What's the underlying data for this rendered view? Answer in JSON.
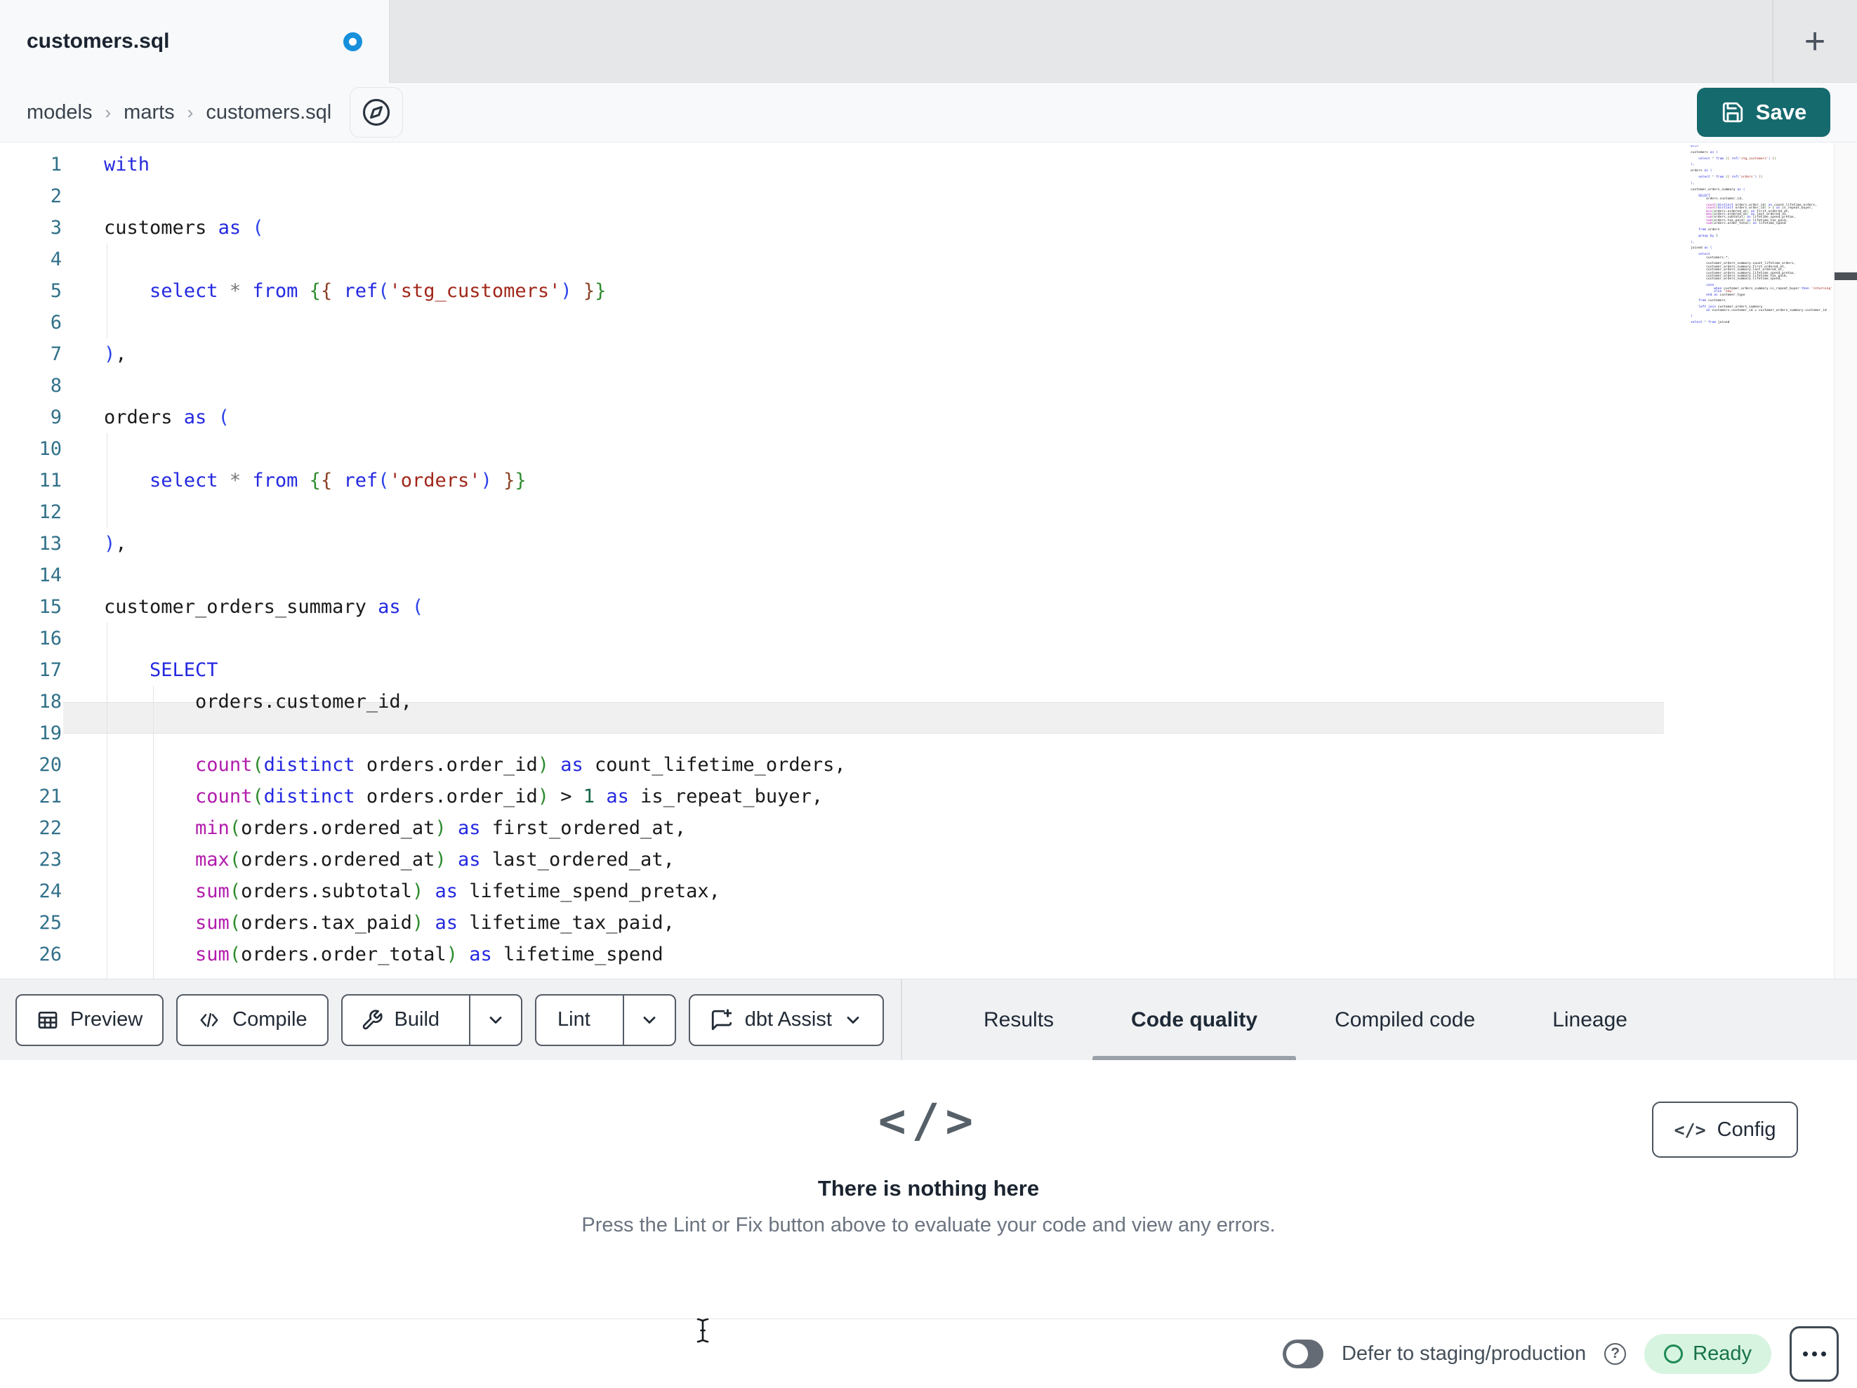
{
  "tab_bar": {
    "title": "customers.sql",
    "unsaved": true,
    "new_tab_glyph": "+"
  },
  "breadcrumb": {
    "items": [
      "models",
      "marts",
      "customers.sql"
    ],
    "separator": "›"
  },
  "save": {
    "label": "Save"
  },
  "colors": {
    "accent_teal": "#156a6e",
    "unsaved_blue": "#1790dc",
    "ready_bg": "#d7f4e1",
    "ready_text": "#177347",
    "keyword": "#2429e0",
    "function": "#b21bac",
    "string": "#a1271b",
    "number": "#116644",
    "bracket1": "#2b43e8",
    "bracket2": "#2e8b2e",
    "bracket3": "#8b4226",
    "line_number": "#31718a"
  },
  "editor": {
    "visible_lines": 26,
    "active_line": 14,
    "file_lines": [
      [
        [
          "kw",
          "with"
        ]
      ],
      [],
      [
        [
          "txt",
          "customers "
        ],
        [
          "kw",
          "as"
        ],
        [
          "txt",
          " "
        ],
        [
          "b",
          "("
        ]
      ],
      [],
      [
        [
          "txt",
          "    "
        ],
        [
          "kw",
          "select"
        ],
        [
          "txt",
          " "
        ],
        [
          "op",
          "*"
        ],
        [
          "txt",
          " "
        ],
        [
          "kw",
          "from"
        ],
        [
          "txt",
          " "
        ],
        [
          "g",
          "{"
        ],
        [
          "m",
          "{"
        ],
        [
          "txt",
          " "
        ],
        [
          "kw",
          "ref"
        ],
        [
          "b",
          "("
        ],
        [
          "str",
          "'stg_customers'"
        ],
        [
          "b",
          ")"
        ],
        [
          "txt",
          " "
        ],
        [
          "m",
          "}"
        ],
        [
          "g",
          "}"
        ]
      ],
      [],
      [
        [
          "b",
          ")"
        ],
        [
          "txt",
          ","
        ]
      ],
      [],
      [
        [
          "txt",
          "orders "
        ],
        [
          "kw",
          "as"
        ],
        [
          "txt",
          " "
        ],
        [
          "b",
          "("
        ]
      ],
      [],
      [
        [
          "txt",
          "    "
        ],
        [
          "kw",
          "select"
        ],
        [
          "txt",
          " "
        ],
        [
          "op",
          "*"
        ],
        [
          "txt",
          " "
        ],
        [
          "kw",
          "from"
        ],
        [
          "txt",
          " "
        ],
        [
          "g",
          "{"
        ],
        [
          "m",
          "{"
        ],
        [
          "txt",
          " "
        ],
        [
          "kw",
          "ref"
        ],
        [
          "b",
          "("
        ],
        [
          "str",
          "'orders'"
        ],
        [
          "b",
          ")"
        ],
        [
          "txt",
          " "
        ],
        [
          "m",
          "}"
        ],
        [
          "g",
          "}"
        ]
      ],
      [],
      [
        [
          "b",
          ")"
        ],
        [
          "txt",
          ","
        ]
      ],
      [],
      [
        [
          "txt",
          "customer_orders_summary "
        ],
        [
          "kw",
          "as"
        ],
        [
          "txt",
          " "
        ],
        [
          "b",
          "("
        ]
      ],
      [],
      [
        [
          "txt",
          "    "
        ],
        [
          "kw",
          "SELECT"
        ]
      ],
      [
        [
          "txt",
          "        orders.customer_id,"
        ]
      ],
      [],
      [
        [
          "txt",
          "        "
        ],
        [
          "fn",
          "count"
        ],
        [
          "g",
          "("
        ],
        [
          "kw",
          "distinct"
        ],
        [
          "txt",
          " orders.order_id"
        ],
        [
          "g",
          ")"
        ],
        [
          "txt",
          " "
        ],
        [
          "kw",
          "as"
        ],
        [
          "txt",
          " count_lifetime_orders,"
        ]
      ],
      [
        [
          "txt",
          "        "
        ],
        [
          "fn",
          "count"
        ],
        [
          "g",
          "("
        ],
        [
          "kw",
          "distinct"
        ],
        [
          "txt",
          " orders.order_id"
        ],
        [
          "g",
          ")"
        ],
        [
          "txt",
          " > "
        ],
        [
          "num",
          "1"
        ],
        [
          "txt",
          " "
        ],
        [
          "kw",
          "as"
        ],
        [
          "txt",
          " is_repeat_buyer,"
        ]
      ],
      [
        [
          "txt",
          "        "
        ],
        [
          "fn",
          "min"
        ],
        [
          "g",
          "("
        ],
        [
          "txt",
          "orders.ordered_at"
        ],
        [
          "g",
          ")"
        ],
        [
          "txt",
          " "
        ],
        [
          "kw",
          "as"
        ],
        [
          "txt",
          " first_ordered_at,"
        ]
      ],
      [
        [
          "txt",
          "        "
        ],
        [
          "fn",
          "max"
        ],
        [
          "g",
          "("
        ],
        [
          "txt",
          "orders.ordered_at"
        ],
        [
          "g",
          ")"
        ],
        [
          "txt",
          " "
        ],
        [
          "kw",
          "as"
        ],
        [
          "txt",
          " last_ordered_at,"
        ]
      ],
      [
        [
          "txt",
          "        "
        ],
        [
          "fn",
          "sum"
        ],
        [
          "g",
          "("
        ],
        [
          "txt",
          "orders.subtotal"
        ],
        [
          "g",
          ")"
        ],
        [
          "txt",
          " "
        ],
        [
          "kw",
          "as"
        ],
        [
          "txt",
          " lifetime_spend_pretax,"
        ]
      ],
      [
        [
          "txt",
          "        "
        ],
        [
          "fn",
          "sum"
        ],
        [
          "g",
          "("
        ],
        [
          "txt",
          "orders.tax_paid"
        ],
        [
          "g",
          ")"
        ],
        [
          "txt",
          " "
        ],
        [
          "kw",
          "as"
        ],
        [
          "txt",
          " lifetime_tax_paid,"
        ]
      ],
      [
        [
          "txt",
          "        "
        ],
        [
          "fn",
          "sum"
        ],
        [
          "g",
          "("
        ],
        [
          "txt",
          "orders.order_total"
        ],
        [
          "g",
          ")"
        ],
        [
          "txt",
          " "
        ],
        [
          "kw",
          "as"
        ],
        [
          "txt",
          " lifetime_spend"
        ]
      ],
      [],
      [
        [
          "txt",
          "    "
        ],
        [
          "kw",
          "from"
        ],
        [
          "txt",
          " orders"
        ]
      ],
      [],
      [
        [
          "txt",
          "    "
        ],
        [
          "kw",
          "group by"
        ],
        [
          "txt",
          " "
        ],
        [
          "num",
          "1"
        ]
      ],
      [],
      [
        [
          "b",
          ")"
        ],
        [
          "txt",
          ","
        ]
      ],
      [],
      [
        [
          "txt",
          "joined "
        ],
        [
          "kw",
          "as"
        ],
        [
          "txt",
          " "
        ],
        [
          "b",
          "("
        ]
      ],
      [],
      [
        [
          "txt",
          "    "
        ],
        [
          "kw",
          "select"
        ]
      ],
      [
        [
          "txt",
          "        customers.*,"
        ]
      ],
      [],
      [
        [
          "txt",
          "        customer_orders_summary.count_lifetime_orders,"
        ]
      ],
      [
        [
          "txt",
          "        customer_orders_summary.first_ordered_at,"
        ]
      ],
      [
        [
          "txt",
          "        customer_orders_summary.last_ordered_at,"
        ]
      ],
      [
        [
          "txt",
          "        customer_orders_summary.lifetime_spend_pretax,"
        ]
      ],
      [
        [
          "txt",
          "        customer_orders_summary.lifetime_tax_paid,"
        ]
      ],
      [
        [
          "txt",
          "        customer_orders_summary.lifetime_spend,"
        ]
      ],
      [],
      [
        [
          "txt",
          "        "
        ],
        [
          "kw",
          "case"
        ]
      ],
      [
        [
          "txt",
          "            "
        ],
        [
          "kw",
          "when"
        ],
        [
          "txt",
          " customer_orders_summary.is_repeat_buyer "
        ],
        [
          "kw",
          "then"
        ],
        [
          "txt",
          " "
        ],
        [
          "str",
          "'returning'"
        ]
      ],
      [
        [
          "txt",
          "            "
        ],
        [
          "kw",
          "else"
        ],
        [
          "txt",
          " "
        ],
        [
          "str",
          "'new'"
        ]
      ],
      [
        [
          "txt",
          "        "
        ],
        [
          "kw",
          "end"
        ],
        [
          "txt",
          " "
        ],
        [
          "kw",
          "as"
        ],
        [
          "txt",
          " customer_type"
        ]
      ],
      [],
      [
        [
          "txt",
          "    "
        ],
        [
          "kw",
          "from"
        ],
        [
          "txt",
          " customers"
        ]
      ],
      [],
      [
        [
          "txt",
          "    "
        ],
        [
          "kw",
          "left join"
        ],
        [
          "txt",
          " customer_orders_summary"
        ]
      ],
      [
        [
          "txt",
          "        "
        ],
        [
          "kw",
          "on"
        ],
        [
          "txt",
          " customers.customer_id = customer_orders_summary.customer_id"
        ]
      ],
      [],
      [
        [
          "b",
          ")"
        ]
      ],
      [],
      [
        [
          "kw",
          "select"
        ],
        [
          "txt",
          " "
        ],
        [
          "op",
          "*"
        ],
        [
          "txt",
          " "
        ],
        [
          "kw",
          "from"
        ],
        [
          "txt",
          " joined"
        ]
      ]
    ]
  },
  "toolbar": {
    "preview": {
      "label": "Preview"
    },
    "compile": {
      "label": "Compile"
    },
    "build": {
      "label": "Build"
    },
    "lint": {
      "label": "Lint"
    },
    "assist": {
      "label": "dbt Assist"
    }
  },
  "tabs": [
    {
      "label": "Results",
      "active": false
    },
    {
      "label": "Code quality",
      "active": true
    },
    {
      "label": "Compiled code",
      "active": false
    },
    {
      "label": "Lineage",
      "active": false
    }
  ],
  "panel": {
    "icon_glyph": "</>",
    "title": "There is nothing here",
    "subtitle": "Press the Lint or Fix button above to evaluate your code and view any errors.",
    "config_label": "Config"
  },
  "status_bar": {
    "toggle_on": false,
    "defer_label": "Defer to staging/production",
    "help_glyph": "?",
    "ready_label": "Ready"
  }
}
